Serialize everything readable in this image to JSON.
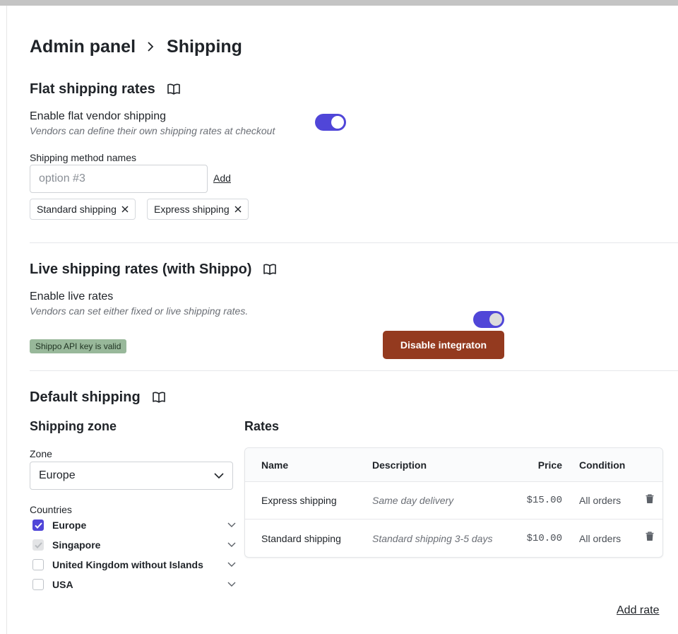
{
  "breadcrumb": {
    "root": "Admin panel",
    "current": "Shipping"
  },
  "flat": {
    "title": "Flat shipping rates",
    "enable_label": "Enable flat vendor shipping",
    "enable_hint": "Vendors can define their own shipping rates at checkout",
    "enabled": true,
    "method_names_label": "Shipping method names",
    "input_placeholder": "option #3",
    "add_label": "Add",
    "chips": [
      "Standard shipping",
      "Express shipping"
    ]
  },
  "live": {
    "title": "Live shipping rates (with Shippo)",
    "enable_label": "Enable live rates",
    "enable_hint": "Vendors can set either fixed or live shipping rates.",
    "enabled": true,
    "badge": "Shippo API key is valid",
    "disable_button": "Disable integraton"
  },
  "default": {
    "title": "Default shipping",
    "zone_title": "Shipping zone",
    "zone_label": "Zone",
    "zone_value": "Europe",
    "countries_label": "Countries",
    "countries": [
      {
        "name": "Europe",
        "state": "checked"
      },
      {
        "name": "Singapore",
        "state": "disabled"
      },
      {
        "name": "United Kingdom without Islands",
        "state": "unchecked"
      },
      {
        "name": "USA",
        "state": "unchecked"
      }
    ],
    "rates_title": "Rates",
    "rates_headers": {
      "name": "Name",
      "description": "Description",
      "price": "Price",
      "condition": "Condition"
    },
    "rates": [
      {
        "name": "Express shipping",
        "description": "Same day delivery",
        "price": "$15.00",
        "condition": "All orders"
      },
      {
        "name": "Standard shipping",
        "description": "Standard shipping 3-5 days",
        "price": "$10.00",
        "condition": "All orders"
      }
    ],
    "add_rate": "Add rate"
  },
  "colors": {
    "accent": "#5046d8",
    "danger": "#943a1f",
    "badge": "#98b89a"
  }
}
